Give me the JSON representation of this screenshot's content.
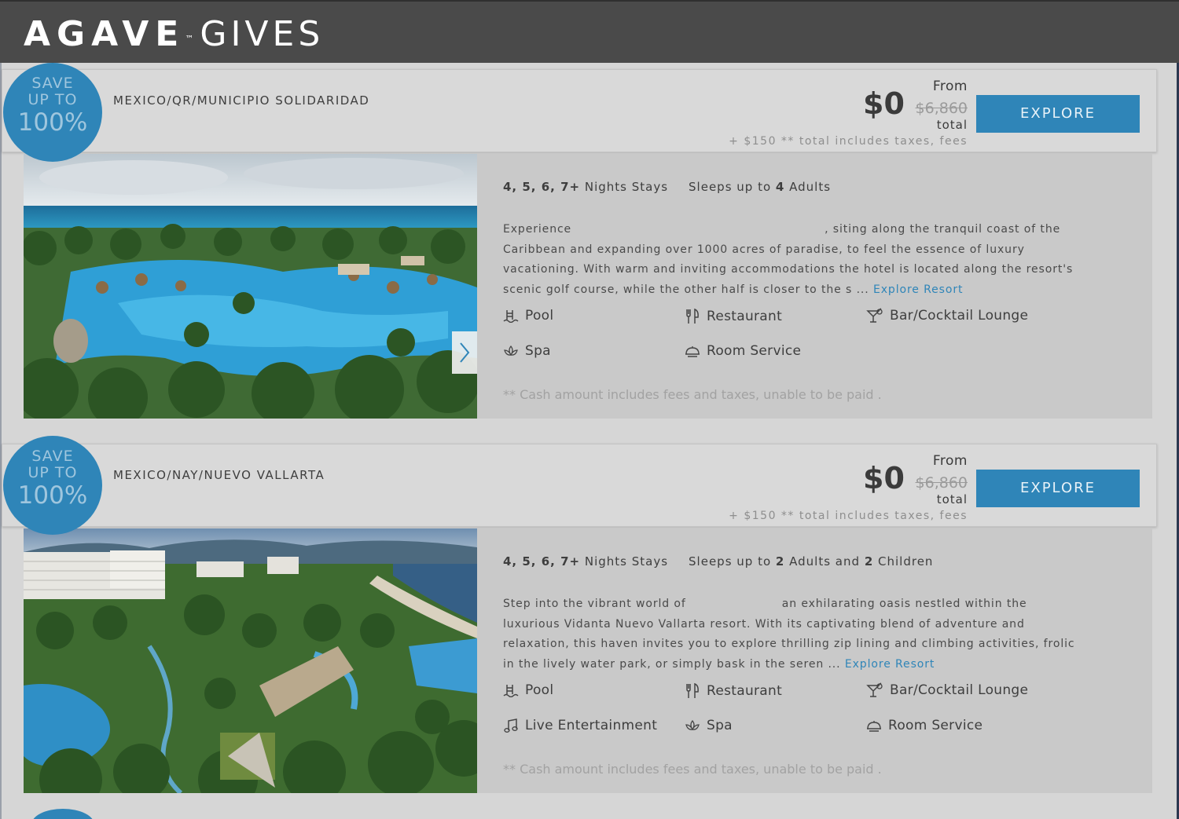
{
  "header": {
    "logo_brand": "AGAVE",
    "logo_tm": "™",
    "logo_sub": "GIVES"
  },
  "listings": [
    {
      "badge": {
        "line1": "SAVE",
        "line2": "UP TO",
        "line3": "100%"
      },
      "location": "MEXICO/QR/MUNICIPIO SOLIDARIDAD",
      "price": {
        "from": "From",
        "amount": "$0",
        "original": "$6,860",
        "total": "total",
        "fees": "+ $150 ** total includes taxes, fees"
      },
      "explore_label": "EXPLORE",
      "stays": {
        "nights": "4, 5, 6, 7+",
        "nights_label": "Nights Stays",
        "sleeps_prefix": "Sleeps up to",
        "adults": "4",
        "adults_label": "Adults"
      },
      "description": {
        "start": "Experience",
        "rest": ", siting along the tranquil coast of the Caribbean and expanding over 1000 acres of paradise, to feel the essence of luxury vacationing. With warm and inviting accommodations the hotel is located along the resort's scenic golf course, while the other half is closer to the s ...",
        "link": "Explore Resort"
      },
      "amenities": [
        "Pool",
        "Restaurant",
        "Bar/Cocktail Lounge",
        "Spa",
        "Room Service"
      ],
      "note": "** Cash amount includes fees and taxes, unable to be paid ."
    },
    {
      "badge": {
        "line1": "SAVE",
        "line2": "UP TO",
        "line3": "100%"
      },
      "location": "MEXICO/NAY/NUEVO VALLARTA",
      "price": {
        "from": "From",
        "amount": "$0",
        "original": "$6,860",
        "total": "total",
        "fees": "+ $150 ** total includes taxes, fees"
      },
      "explore_label": "EXPLORE",
      "stays": {
        "nights": "4, 5, 6, 7+",
        "nights_label": "Nights Stays",
        "sleeps_prefix": "Sleeps up to",
        "adults": "2",
        "adults_label": "Adults and",
        "children": "2",
        "children_label": "Children"
      },
      "description": {
        "start": "Step into the vibrant world of",
        "rest": "an exhilarating oasis nestled within the luxurious Vidanta Nuevo Vallarta resort. With its captivating blend of adventure and relaxation, this haven invites you to explore thrilling zip lining and climbing activities, frolic in the lively water park, or simply bask in the seren ...",
        "link": "Explore Resort"
      },
      "amenities": [
        "Pool",
        "Restaurant",
        "Bar/Cocktail Lounge",
        "Live Entertainment",
        "Spa",
        "Room Service"
      ],
      "note": "** Cash amount includes fees and taxes, unable to be paid ."
    }
  ]
}
